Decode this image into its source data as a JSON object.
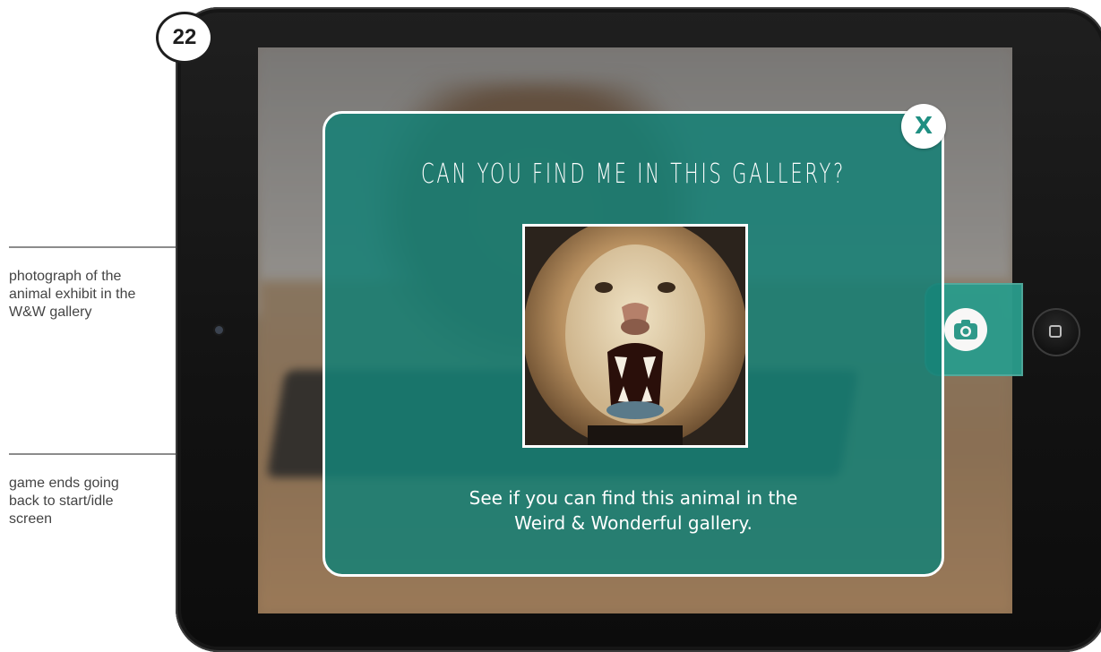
{
  "page_number": "22",
  "annotations": [
    {
      "text": "photograph of the animal exhibit in the W&W  gallery"
    },
    {
      "text": "game ends going back to start/idle screen"
    }
  ],
  "popup": {
    "title": "CAN YOU FIND ME IN THIS GALLERY?",
    "description_line1": "See if you can find this animal in the",
    "description_line2": "Weird & Wonderful gallery.",
    "close_label": "X",
    "image_icon": "lion-photo"
  },
  "camera_button": {
    "icon": "camera-icon"
  },
  "colors": {
    "popup_teal": "#1a857b",
    "accent_teal": "#1f8f82",
    "text_white": "#ffffff"
  }
}
